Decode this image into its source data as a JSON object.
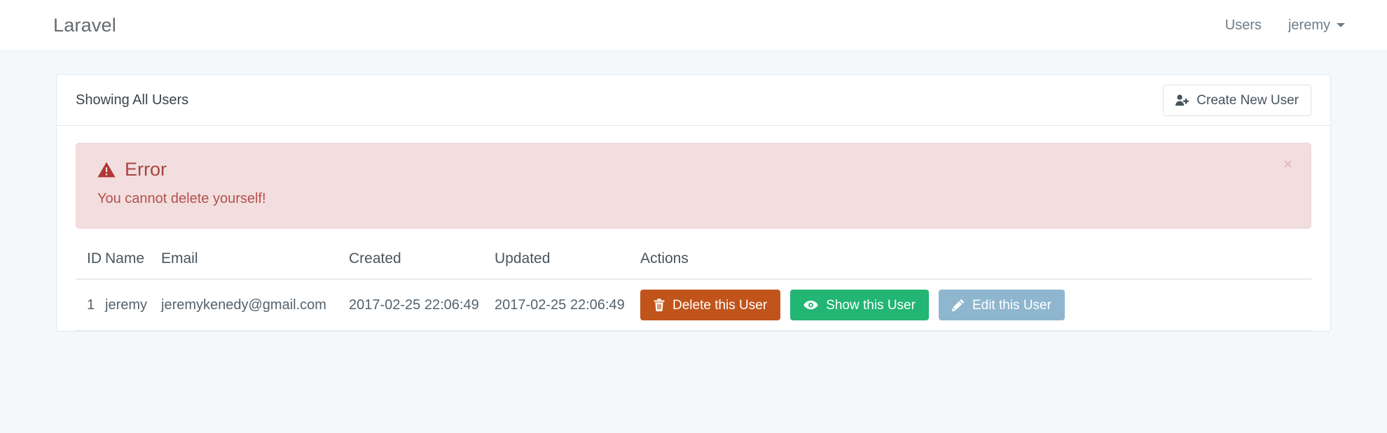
{
  "navbar": {
    "brand": "Laravel",
    "users_link": "Users",
    "username": "jeremy",
    "caret_icon": "chevron-down-icon"
  },
  "card": {
    "title": "Showing All Users",
    "create_button": {
      "label": "Create New User",
      "icon": "user-plus-icon"
    }
  },
  "alert": {
    "type": "error",
    "icon": "warning-triangle-icon",
    "title": "Error",
    "message": "You cannot delete yourself!",
    "close_label": "×",
    "background_color": "#f2dede",
    "text_color": "#a94442"
  },
  "table": {
    "headers": [
      "ID",
      "Name",
      "Email",
      "Created",
      "Updated",
      "Actions"
    ],
    "rows": [
      {
        "id": "1",
        "name": "jeremy",
        "email": "jeremykenedy@gmail.com",
        "created": "2017-02-25 22:06:49",
        "updated": "2017-02-25 22:06:49",
        "actions": {
          "delete": {
            "label": "Delete this User",
            "icon": "trash-icon",
            "color": "#c1541a"
          },
          "show": {
            "label": "Show this User",
            "icon": "eye-icon",
            "color": "#22b573"
          },
          "edit": {
            "label": "Edit this User",
            "icon": "pencil-icon",
            "color": "#8fb6cf"
          }
        }
      }
    ]
  }
}
